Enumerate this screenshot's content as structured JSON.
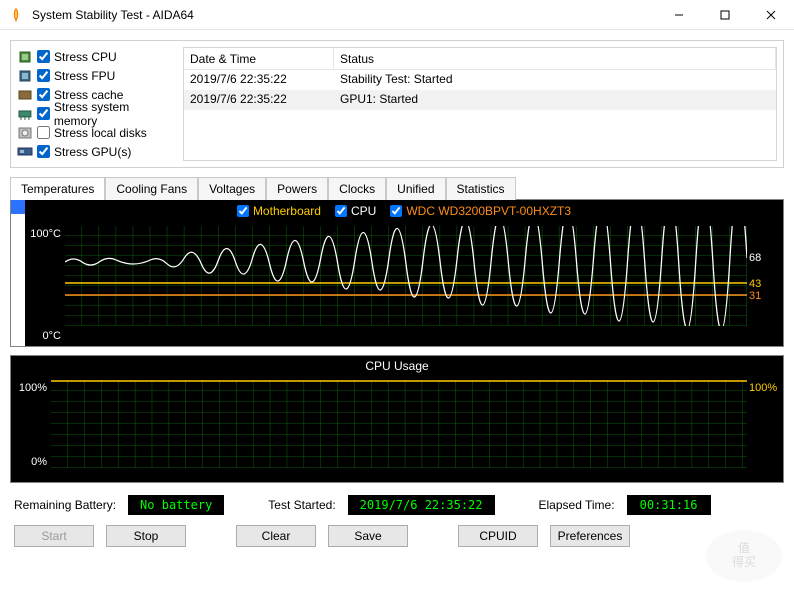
{
  "window": {
    "title": "System Stability Test - AIDA64"
  },
  "stress_options": [
    {
      "label": "Stress CPU",
      "checked": true
    },
    {
      "label": "Stress FPU",
      "checked": true
    },
    {
      "label": "Stress cache",
      "checked": true
    },
    {
      "label": "Stress system memory",
      "checked": true
    },
    {
      "label": "Stress local disks",
      "checked": false
    },
    {
      "label": "Stress GPU(s)",
      "checked": true
    }
  ],
  "log": {
    "headers": {
      "datetime": "Date & Time",
      "status": "Status"
    },
    "rows": [
      {
        "datetime": "2019/7/6 22:35:22",
        "status": "Stability Test: Started"
      },
      {
        "datetime": "2019/7/6 22:35:22",
        "status": "GPU1: Started"
      }
    ]
  },
  "tabs": [
    "Temperatures",
    "Cooling Fans",
    "Voltages",
    "Powers",
    "Clocks",
    "Unified",
    "Statistics"
  ],
  "active_tab": 0,
  "chart_data": [
    {
      "type": "line",
      "title": "",
      "ylim": [
        0,
        100
      ],
      "ylabel_top": "100°C",
      "ylabel_bottom": "0°C",
      "series": [
        {
          "name": "Motherboard",
          "color": "#ffcc00",
          "current": 43,
          "approx_value": 43
        },
        {
          "name": "CPU",
          "color": "#ffffff",
          "current": 68,
          "approx_value_range": [
            58,
            72
          ]
        },
        {
          "name": "WDC WD3200BPVT-00HXZT3",
          "color": "#ff8c1a",
          "current": 31,
          "approx_value": 31
        }
      ]
    },
    {
      "type": "line",
      "title": "CPU Usage",
      "ylim": [
        0,
        100
      ],
      "ylabel_top": "100%",
      "ylabel_bottom": "0%",
      "series": [
        {
          "name": "CPU Usage",
          "color": "#ffcc00",
          "current": "100%",
          "approx_value": 100
        }
      ]
    }
  ],
  "status": {
    "battery_label": "Remaining Battery:",
    "battery_value": "No battery",
    "started_label": "Test Started:",
    "started_value": "2019/7/6 22:35:22",
    "elapsed_label": "Elapsed Time:",
    "elapsed_value": "00:31:16"
  },
  "buttons": {
    "start": "Start",
    "stop": "Stop",
    "clear": "Clear",
    "save": "Save",
    "cpuid": "CPUID",
    "preferences": "Preferences"
  }
}
